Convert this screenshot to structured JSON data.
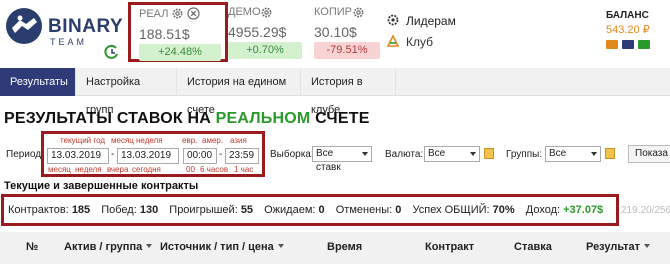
{
  "logo": {
    "line1": "BINARY",
    "line2": "TEAM"
  },
  "accounts": [
    {
      "name": "РЕАЛ",
      "amount": "188.51$",
      "change": "+24.48%",
      "trend": "pos"
    },
    {
      "name": "ДЕМО",
      "amount": "4955.29$",
      "change": "+0.70%",
      "trend": "pos"
    },
    {
      "name": "КОПИР",
      "amount": "30.10$",
      "change": "-79.51%",
      "trend": "neg"
    }
  ],
  "header_menu": {
    "leaders": "Лидерам",
    "club": "Клуб"
  },
  "balance": {
    "label": "БАЛАНС",
    "value": "543.20 ₽"
  },
  "nav": {
    "tabs": [
      {
        "label": "Результаты",
        "active": true
      },
      {
        "label": "Настройка групп",
        "active": false
      },
      {
        "label": "История на едином счете",
        "active": false
      },
      {
        "label": "История в клубе",
        "active": false
      }
    ]
  },
  "page": {
    "title_prefix": "РЕЗУЛЬТАТЫ СТАВОК НА ",
    "title_highlight": "РЕАЛЬНОМ",
    "title_suffix": " СЧЕТЕ"
  },
  "filters": {
    "period_label": "Период",
    "hints_top": {
      "current_year": "текущий год",
      "month": "месяц",
      "week": "неделя",
      "eur": "евр.",
      "amer": "амер.",
      "asia": "азия"
    },
    "hints_bottom": {
      "month": "месяц",
      "week": "неделя",
      "yesterday": "вчера",
      "today": "сегодня",
      "h0": "00",
      "h6": "6 часов",
      "h1": "1 час"
    },
    "date_from": "13.03.2019",
    "date_sep": "-",
    "date_to": "13.03.2019",
    "time_from": "00:00",
    "time_sep": "-",
    "time_to": "23:59",
    "selection_label": "Выборка:",
    "selection_value": "Все ставк",
    "currency_label": "Валюта:",
    "currency_value": "Все",
    "groups_label": "Группы:",
    "groups_value": "Все",
    "show_button": "Показа"
  },
  "contracts": {
    "title": "Текущие и завершенные контракты",
    "contracts_label": "Контрактов:",
    "contracts_value": "185",
    "wins_label": "Побед:",
    "wins_value": "130",
    "losses_label": "Проигрышей:",
    "losses_value": "55",
    "pending_label": "Ожидаем:",
    "pending_value": "0",
    "cancelled_label": "Отменены:",
    "cancelled_value": "0",
    "success_label": "Успех ОБЩИЙ:",
    "success_value": "70%",
    "income_label": "Доход:",
    "income_value": "+37.07$",
    "faded_value": "219.20/256"
  },
  "table": {
    "headers": [
      "№",
      "Актив / группа",
      "Источник / тип / цена",
      "Время",
      "Контракт",
      "Ставка",
      "Результат"
    ]
  },
  "colors": {
    "nav_active": "#2f3b78",
    "highlight_border": "#9b1a1e",
    "positive": "#2b9a2b",
    "balance": "#e08a1e"
  }
}
